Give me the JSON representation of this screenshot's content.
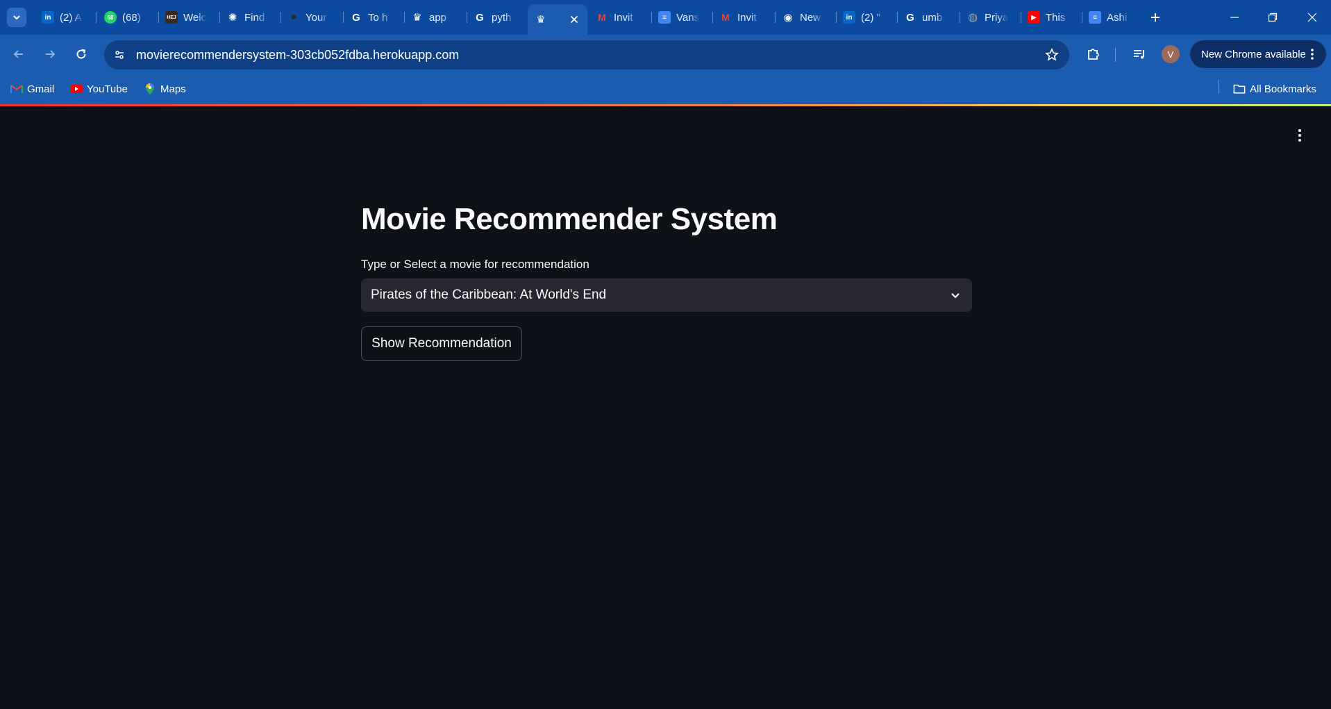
{
  "browser": {
    "tabs": [
      {
        "title": "(2) A",
        "icon": "linkedin-icon",
        "color": "#0a66c2"
      },
      {
        "title": "(68)",
        "icon": "whatsapp-icon",
        "color": "#25d366"
      },
      {
        "title": "Welc",
        "icon": "hej-icon",
        "color": "#3b2a1a"
      },
      {
        "title": "Find",
        "icon": "chatgpt-icon",
        "color": "#ffffff"
      },
      {
        "title": "Your",
        "icon": "github-icon",
        "color": "#24292e"
      },
      {
        "title": "To h",
        "icon": "google-icon",
        "color": "#ffffff"
      },
      {
        "title": "app",
        "icon": "streamlit-icon",
        "color": "#ffffff"
      },
      {
        "title": "pyth",
        "icon": "google-icon",
        "color": "#ffffff"
      },
      {
        "title": "",
        "icon": "streamlit-icon",
        "color": "#ffffff",
        "active": true
      },
      {
        "title": "Invit",
        "icon": "gmail-icon",
        "color": "#ea4335"
      },
      {
        "title": "Vans",
        "icon": "docs-icon",
        "color": "#4285f4"
      },
      {
        "title": "Invit",
        "icon": "gmail-icon",
        "color": "#ea4335"
      },
      {
        "title": "New",
        "icon": "chrome-icon",
        "color": "#ffffff"
      },
      {
        "title": "(2) \"",
        "icon": "linkedin-icon",
        "color": "#0a66c2"
      },
      {
        "title": "umb",
        "icon": "google-icon",
        "color": "#ffffff"
      },
      {
        "title": "Priya",
        "icon": "globe-icon",
        "color": "#9aa0a6"
      },
      {
        "title": "This",
        "icon": "youtube-icon",
        "color": "#ff0000"
      },
      {
        "title": "Ashi",
        "icon": "docs-icon",
        "color": "#4285f4"
      }
    ],
    "url": "movierecommendersystem-303cb052fdba.herokuapp.com",
    "profile_initial": "V",
    "update_label": "New Chrome available",
    "bookmarks": [
      {
        "label": "Gmail",
        "icon": "gmail-icon"
      },
      {
        "label": "YouTube",
        "icon": "youtube-icon"
      },
      {
        "label": "Maps",
        "icon": "maps-icon"
      }
    ],
    "all_bookmarks_label": "All Bookmarks"
  },
  "app": {
    "title": "Movie Recommender System",
    "select_label": "Type or Select a movie for recommendation",
    "selected_movie": "Pirates of the Caribbean: At World's End",
    "button_label": "Show Recommendation"
  }
}
